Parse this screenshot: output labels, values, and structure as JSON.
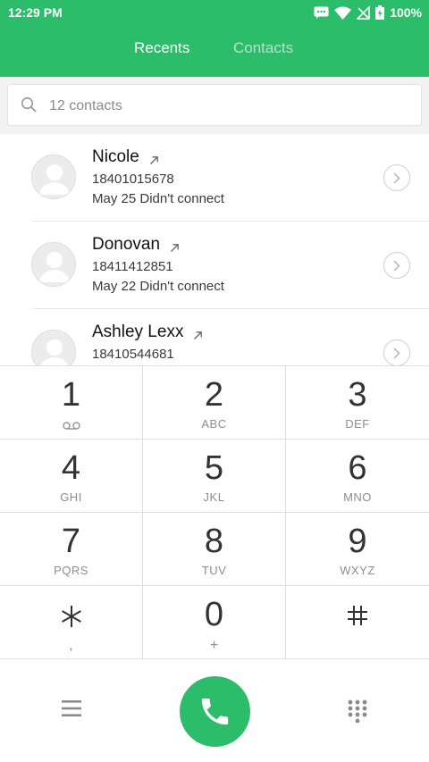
{
  "status_bar": {
    "time": "12:29 PM",
    "battery": "100%"
  },
  "tabs": [
    {
      "label": "Recents",
      "active": true
    },
    {
      "label": "Contacts",
      "active": false
    }
  ],
  "search": {
    "placeholder": "12 contacts"
  },
  "calls": [
    {
      "name": "Nicole",
      "number": "18401015678",
      "status": "May 25 Didn't connect"
    },
    {
      "name": "Donovan",
      "number": "18411412851",
      "status": "May 22 Didn't connect"
    },
    {
      "name": "Ashley Lexx",
      "number": "18410544681",
      "status": ""
    }
  ],
  "dialpad": {
    "keys": [
      {
        "digit": "1",
        "letters": ""
      },
      {
        "digit": "2",
        "letters": "ABC"
      },
      {
        "digit": "3",
        "letters": "DEF"
      },
      {
        "digit": "4",
        "letters": "GHI"
      },
      {
        "digit": "5",
        "letters": "JKL"
      },
      {
        "digit": "6",
        "letters": "MNO"
      },
      {
        "digit": "7",
        "letters": "PQRS"
      },
      {
        "digit": "8",
        "letters": "TUV"
      },
      {
        "digit": "9",
        "letters": "WXYZ"
      },
      {
        "digit": "*",
        "letters": ","
      },
      {
        "digit": "0",
        "letters": "+"
      },
      {
        "digit": "#",
        "letters": ""
      }
    ]
  },
  "colors": {
    "accent": "#2cbd6a",
    "tab_inactive": "#a8e4c2"
  },
  "icons": {
    "menu": "menu-icon",
    "call": "phone-icon",
    "dialpad_toggle": "dialpad-grid-icon",
    "search": "search-icon",
    "outgoing": "outgoing-call-arrow-icon",
    "detail": "chevron-right-icon",
    "voicemail": "voicemail-icon"
  }
}
